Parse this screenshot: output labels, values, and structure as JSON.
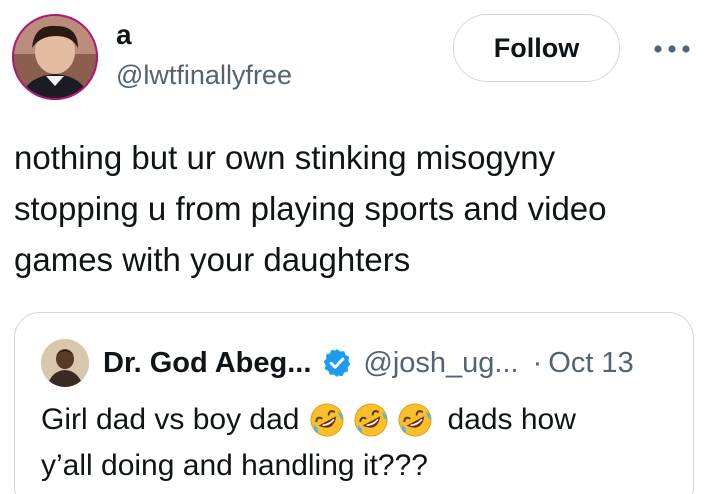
{
  "author": {
    "display_name": "a",
    "handle": "@lwtfinallyfree"
  },
  "header": {
    "follow_label": "Follow",
    "more_icon": "more-horizontal-icon"
  },
  "tweet": {
    "lines": [
      "nothing but ur own stinking misogyny",
      "stopping u from playing sports and video",
      "games with your daughters"
    ]
  },
  "quote": {
    "display_name": "Dr. God Abeg...",
    "badge_icon": "verified-badge-icon",
    "handle": "@josh_ug...",
    "separator": "·",
    "date": "Oct 13",
    "line1_start": "Girl dad vs boy dad",
    "emojis": [
      "rolling-on-floor-laughing",
      "rolling-on-floor-laughing",
      "rolling-on-floor-laughing"
    ],
    "line1_end": "dads how",
    "line2": "y’all doing and handling it???"
  },
  "colors": {
    "text": "#0f1419",
    "secondary": "#536471",
    "border": "#cfd9de",
    "verified": "#1d9bf0",
    "avatar_ring": "#b0177a"
  }
}
